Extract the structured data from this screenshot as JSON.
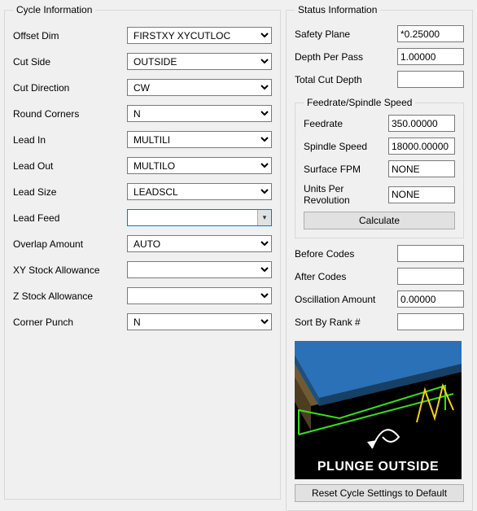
{
  "cycle": {
    "legend": "Cycle Information",
    "offset_dim": {
      "label": "Offset Dim",
      "value": "FIRSTXY XYCUTLOC"
    },
    "cut_side": {
      "label": "Cut Side",
      "value": "OUTSIDE"
    },
    "cut_direction": {
      "label": "Cut Direction",
      "value": "CW"
    },
    "round_corners": {
      "label": "Round Corners",
      "value": "N"
    },
    "lead_in": {
      "label": "Lead In",
      "value": "MULTILI"
    },
    "lead_out": {
      "label": "Lead Out",
      "value": "MULTILO"
    },
    "lead_size": {
      "label": "Lead Size",
      "value": "LEADSCL"
    },
    "lead_feed": {
      "label": "Lead Feed",
      "value": ""
    },
    "overlap_amount": {
      "label": "Overlap Amount",
      "value": "AUTO"
    },
    "xy_stock": {
      "label": "XY Stock Allowance",
      "value": ""
    },
    "z_stock": {
      "label": "Z Stock Allowance",
      "value": ""
    },
    "corner_punch": {
      "label": "Corner Punch",
      "value": "N"
    }
  },
  "status": {
    "legend": "Status Information",
    "safety_plane": {
      "label": "Safety Plane",
      "value": "*0.25000"
    },
    "depth_per_pass": {
      "label": "Depth Per Pass",
      "value": "1.00000"
    },
    "total_cut_depth": {
      "label": "Total Cut Depth",
      "value": ""
    },
    "feed_legend": "Feedrate/Spindle Speed",
    "feedrate": {
      "label": "Feedrate",
      "value": "350.00000"
    },
    "spindle_speed": {
      "label": "Spindle Speed",
      "value": "18000.00000"
    },
    "surface_fpm": {
      "label": "Surface FPM",
      "value": "NONE"
    },
    "units_per_rev": {
      "label": "Units Per Revolution",
      "value": "NONE"
    },
    "calculate": "Calculate",
    "before_codes": {
      "label": "Before Codes",
      "value": ""
    },
    "after_codes": {
      "label": "After Codes",
      "value": ""
    },
    "oscillation": {
      "label": "Oscillation Amount",
      "value": "0.00000"
    },
    "sort_rank": {
      "label": "Sort By Rank #",
      "value": ""
    },
    "preview_caption": "PLUNGE OUTSIDE",
    "reset": "Reset Cycle Settings to Default"
  }
}
